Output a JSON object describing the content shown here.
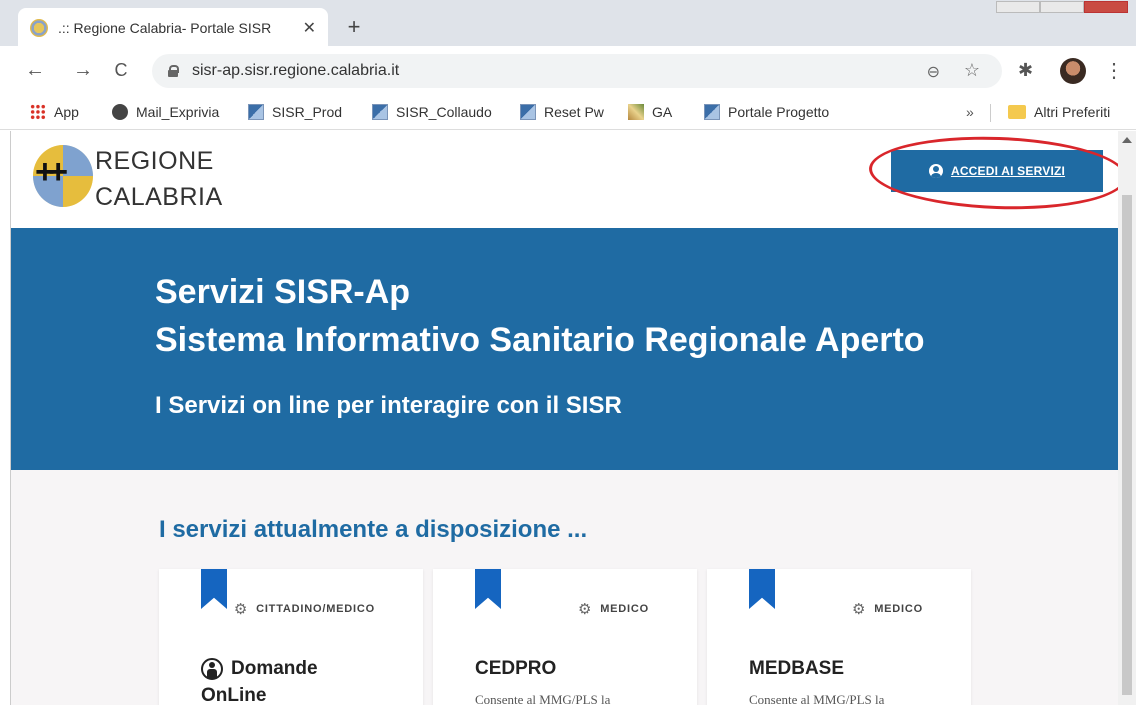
{
  "browser": {
    "tab_title": ".:: Regione Calabria- Portale SISR",
    "tab_close": "✕",
    "new_tab": "+",
    "url": "sisr-ap.sisr.regione.calabria.it",
    "back": "←",
    "forward": "→",
    "reload": "C",
    "zoom_icon": "⊖",
    "star_icon": "☆",
    "ext_icon": "✱",
    "menu_icon": "⋮"
  },
  "bookmarks": {
    "items": [
      {
        "label": "App",
        "icon": "apps-grid-icon"
      },
      {
        "label": "Mail_Exprivia",
        "icon": "globe-icon"
      },
      {
        "label": "SISR_Prod",
        "icon": "sisr-icon"
      },
      {
        "label": "SISR_Collaudo",
        "icon": "sisr-icon"
      },
      {
        "label": "Reset Pw",
        "icon": "sisr-icon"
      },
      {
        "label": "GA",
        "icon": "ga-icon"
      },
      {
        "label": "Portale Progetto",
        "icon": "sisr-icon"
      }
    ],
    "more": "»",
    "other_label": "Altri Preferiti"
  },
  "header": {
    "brand_line1": "REGIONE",
    "brand_line2": "CALABRIA",
    "login_label": "ACCEDI AI SERVIZI",
    "highlight_color": "#d9262b"
  },
  "hero": {
    "title_line1": "Servizi SISR-Ap",
    "title_line2": "Sistema Informativo Sanitario Regionale Aperto",
    "subtitle": "I Servizi on line per interagire con il SISR",
    "background": "#1f6ba3"
  },
  "services": {
    "heading": "I servizi attualmente a disposizione ...",
    "cards": [
      {
        "tag": "CITTADINO/MEDICO",
        "title_line1": "Domande",
        "title_line2": "OnLine",
        "description": ""
      },
      {
        "tag": "MEDICO",
        "title_line1": "CEDPRO",
        "title_line2": "",
        "description": "Consente al MMG/PLS la"
      },
      {
        "tag": "MEDICO",
        "title_line1": "MEDBASE",
        "title_line2": "",
        "description": "Consente al MMG/PLS la"
      }
    ]
  }
}
